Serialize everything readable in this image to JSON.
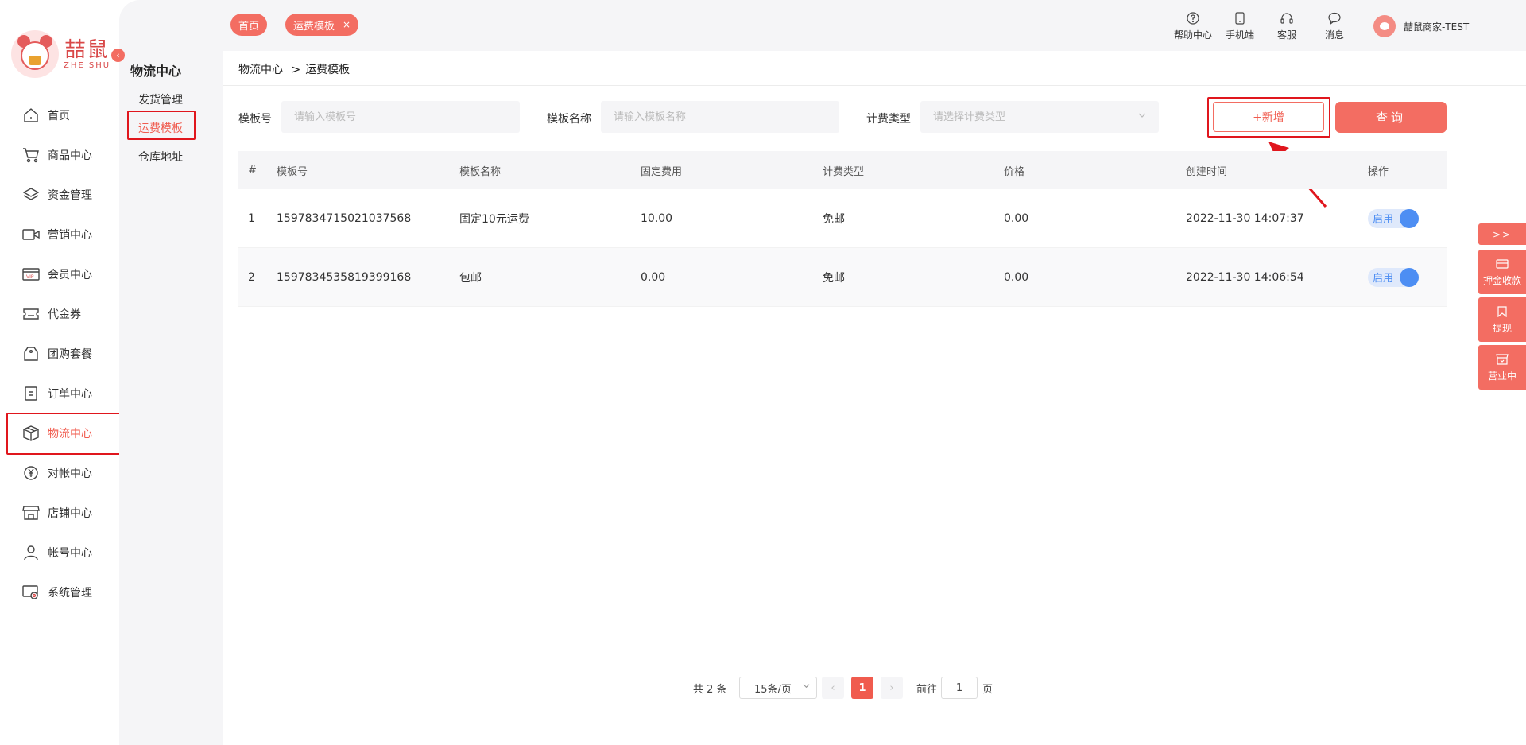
{
  "logo": {
    "cn": "喆鼠",
    "en": "ZHE SHU"
  },
  "collapse_icon": "‹",
  "menu": [
    {
      "label": "首页",
      "icon": "home-icon"
    },
    {
      "label": "商品中心",
      "icon": "cart-icon"
    },
    {
      "label": "资金管理",
      "icon": "layers-icon"
    },
    {
      "label": "营销中心",
      "icon": "video-icon"
    },
    {
      "label": "会员中心",
      "icon": "vip-card-icon"
    },
    {
      "label": "代金券",
      "icon": "ticket-icon"
    },
    {
      "label": "团购套餐",
      "icon": "tag-icon"
    },
    {
      "label": "订单中心",
      "icon": "order-icon"
    },
    {
      "label": "物流中心",
      "icon": "box-icon"
    },
    {
      "label": "对帐中心",
      "icon": "yuan-icon"
    },
    {
      "label": "店铺中心",
      "icon": "store-icon"
    },
    {
      "label": "帐号中心",
      "icon": "user-icon"
    },
    {
      "label": "系统管理",
      "icon": "settings-icon"
    }
  ],
  "subnav": {
    "title": "物流中心",
    "items": [
      "发货管理",
      "运费模板",
      "仓库地址"
    ]
  },
  "tabs": [
    {
      "label": "首页"
    },
    {
      "label": "运费模板",
      "close": "×"
    }
  ],
  "top_tools": [
    {
      "label": "帮助中心",
      "icon": "help-icon"
    },
    {
      "label": "手机端",
      "icon": "phone-icon"
    },
    {
      "label": "客服",
      "icon": "headset-icon"
    },
    {
      "label": "消息",
      "icon": "message-icon"
    }
  ],
  "user": {
    "name": "喆鼠商家-TEST"
  },
  "breadcrumb": {
    "parent": "物流中心",
    "sep": ">",
    "current": "运费模板"
  },
  "filters": {
    "template_no_label": "模板号",
    "template_no_placeholder": "请输入模板号",
    "template_name_label": "模板名称",
    "template_name_placeholder": "请输入模板名称",
    "billing_type_label": "计费类型",
    "billing_type_placeholder": "请选择计费类型",
    "add_label": "+新增",
    "query_label": "查询"
  },
  "table": {
    "headers": [
      "#",
      "模板号",
      "模板名称",
      "固定费用",
      "计费类型",
      "价格",
      "创建时间",
      "操作"
    ],
    "rows": [
      {
        "idx": "1",
        "no": "1597834715021037568",
        "name": "固定10元运费",
        "fixed": "10.00",
        "type": "免邮",
        "price": "0.00",
        "created": "2022-11-30 14:07:37",
        "status": "启用"
      },
      {
        "idx": "2",
        "no": "1597834535819399168",
        "name": "包邮",
        "fixed": "0.00",
        "type": "免邮",
        "price": "0.00",
        "created": "2022-11-30 14:06:54",
        "status": "启用"
      }
    ]
  },
  "pagination": {
    "total": "共 2 条",
    "page_size": "15条/页",
    "prev": "‹",
    "current": "1",
    "next": "›",
    "goto_label": "前往",
    "goto_value": "1",
    "goto_suffix": "页"
  },
  "float_panel": {
    "toggle": ">>",
    "items": [
      {
        "label": "押金收款",
        "icon": "wallet-icon"
      },
      {
        "label": "提现",
        "icon": "bookmark-icon"
      },
      {
        "label": "营业中",
        "icon": "shop-open-icon"
      }
    ]
  },
  "colors": {
    "accent": "#f36d62",
    "highlight_red": "#e0161d",
    "switch_blue": "#4d8ef3"
  }
}
